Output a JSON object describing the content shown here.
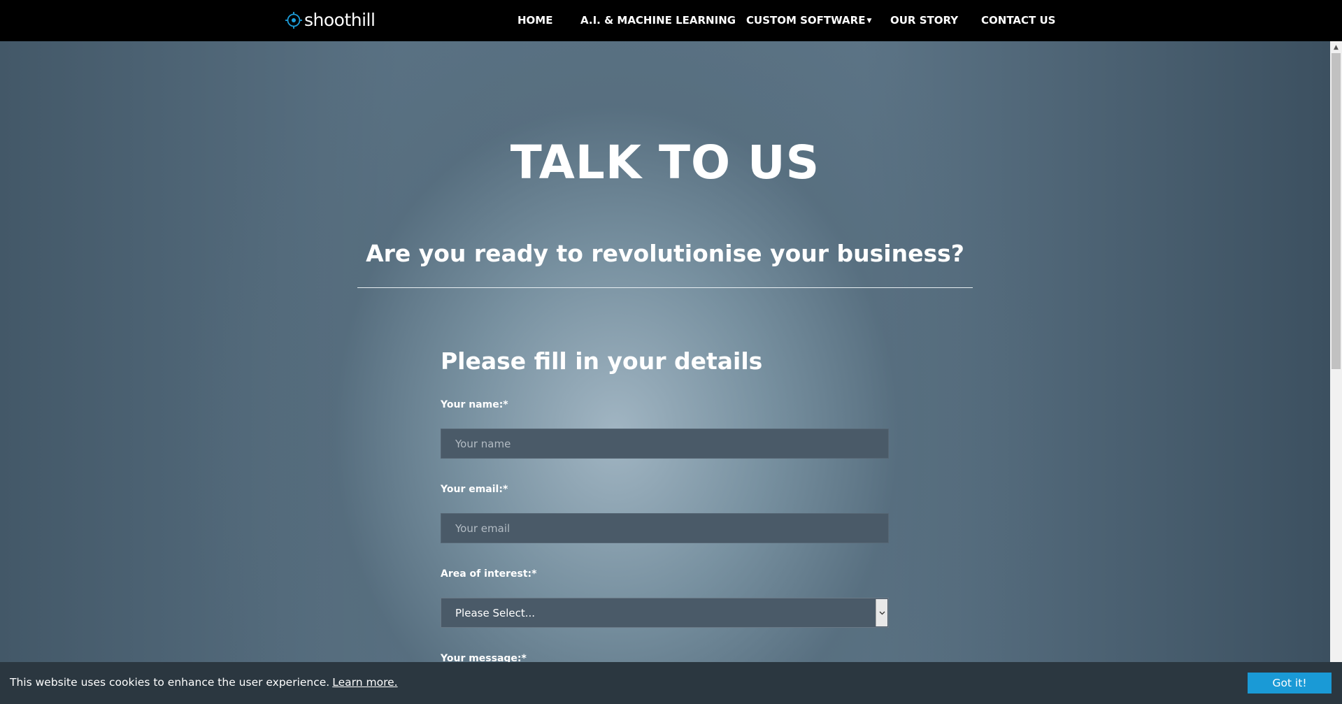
{
  "header": {
    "logo_text": "shoothill",
    "nav": [
      {
        "label": "HOME"
      },
      {
        "label": "A.I. & MACHINE LEARNING"
      },
      {
        "label": "CUSTOM SOFTWARE"
      },
      {
        "label": "OUR STORY"
      },
      {
        "label": "CONTACT US"
      }
    ]
  },
  "hero": {
    "title": "TALK TO US",
    "subtitle": "Are you ready to revolutionise your business?"
  },
  "form": {
    "heading": "Please fill in your details",
    "name": {
      "label": "Your name:*",
      "placeholder": "Your name"
    },
    "email": {
      "label": "Your email:*",
      "placeholder": "Your email"
    },
    "interest": {
      "label": "Area of interest:*",
      "selected": "Please Select..."
    },
    "message": {
      "label": "Your message:*"
    }
  },
  "cookie": {
    "text": "This website uses cookies to enhance the user experience.",
    "link": "Learn more.",
    "button": "Got it!"
  },
  "colors": {
    "nav_bg": "#000000",
    "cookie_bg": "#2b3740",
    "cookie_button": "#1a9ad6",
    "logo_accent": "#1e9fdc"
  }
}
